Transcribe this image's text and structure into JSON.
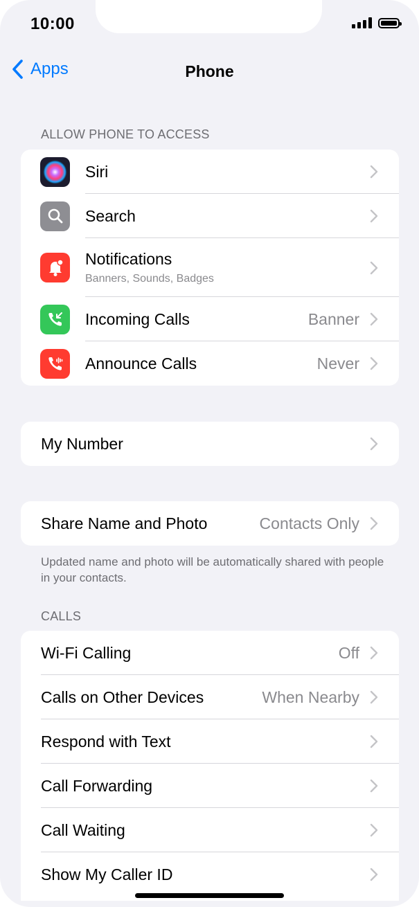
{
  "status_bar": {
    "time": "10:00"
  },
  "nav": {
    "back_label": "Apps",
    "title": "Phone"
  },
  "access_section": {
    "header": "ALLOW PHONE TO ACCESS",
    "rows": [
      {
        "label": "Siri",
        "icon": "siri-icon"
      },
      {
        "label": "Search",
        "icon": "search-icon"
      },
      {
        "label": "Notifications",
        "subtitle": "Banners, Sounds, Badges",
        "icon": "notifications-icon"
      },
      {
        "label": "Incoming Calls",
        "value": "Banner",
        "icon": "incoming-calls-icon"
      },
      {
        "label": "Announce Calls",
        "value": "Never",
        "icon": "announce-calls-icon"
      }
    ]
  },
  "my_number": {
    "label": "My Number"
  },
  "share_section": {
    "label": "Share Name and Photo",
    "value": "Contacts Only",
    "footer": "Updated name and photo will be automatically shared with people in your contacts."
  },
  "calls_section": {
    "header": "CALLS",
    "rows": [
      {
        "label": "Wi-Fi Calling",
        "value": "Off"
      },
      {
        "label": "Calls on Other Devices",
        "value": "When Nearby"
      },
      {
        "label": "Respond with Text"
      },
      {
        "label": "Call Forwarding"
      },
      {
        "label": "Call Waiting"
      },
      {
        "label": "Show My Caller ID"
      }
    ]
  },
  "colors": {
    "accent": "#007aff",
    "background": "#f2f2f7",
    "search_icon_bg": "#8e8e93",
    "notifications_icon_bg": "#ff3b30",
    "incoming_calls_icon_bg": "#34c759",
    "announce_calls_icon_bg": "#ff3b30"
  }
}
